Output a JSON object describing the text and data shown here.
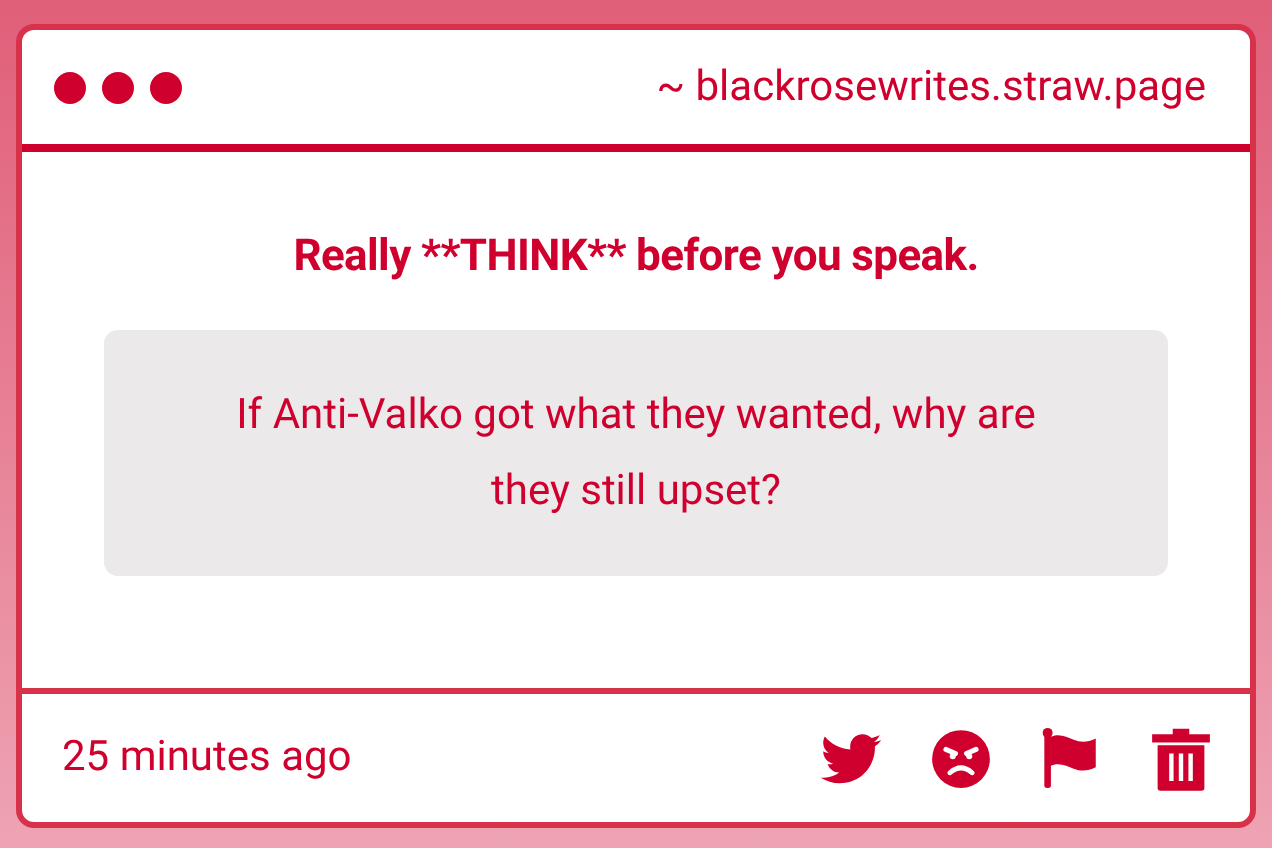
{
  "window": {
    "url": "~ blackrosewrites.straw.page"
  },
  "prompt": "Really **THINK** before you speak.",
  "message": "If Anti-Valko got what they wanted, why are they still upset?",
  "footer": {
    "time": "25 minutes ago",
    "actions": [
      {
        "kind": "twitter"
      },
      {
        "kind": "angry"
      },
      {
        "kind": "flag"
      },
      {
        "kind": "trash"
      }
    ]
  }
}
